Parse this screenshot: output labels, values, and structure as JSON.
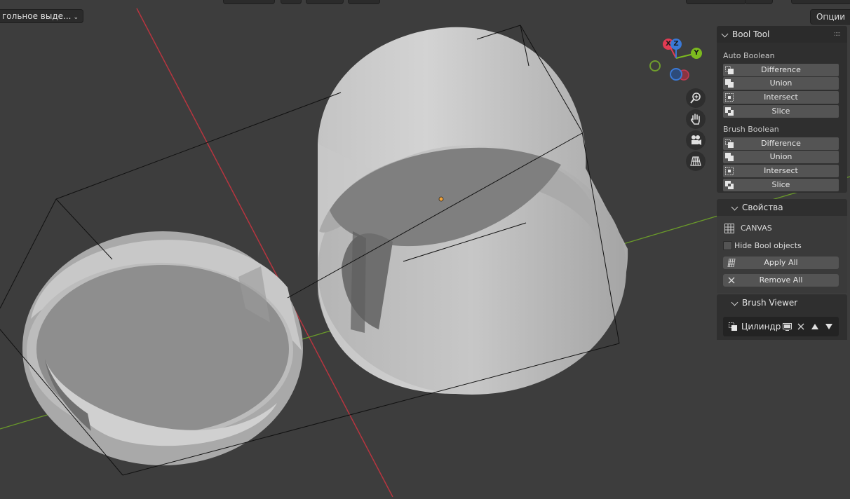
{
  "header": {
    "select_mode_label": "гольное выде...",
    "options_label": "Опции"
  },
  "gizmo": {
    "x_label": "X",
    "y_label": "Y",
    "z_label": "Z",
    "colors": {
      "x": "#e23b53",
      "y": "#7cba1f",
      "z": "#3a79d7"
    }
  },
  "nav_icons": [
    "zoom-icon",
    "pan-hand-icon",
    "camera-icon",
    "grid-icon"
  ],
  "bool_tool": {
    "title": "Bool Tool",
    "auto_boolean": {
      "label": "Auto Boolean",
      "buttons": [
        "Difference",
        "Union",
        "Intersect",
        "Slice"
      ]
    },
    "brush_boolean": {
      "label": "Brush Boolean",
      "buttons": [
        "Difference",
        "Union",
        "Intersect",
        "Slice"
      ]
    }
  },
  "properties": {
    "title": "Свойства",
    "canvas_label": "CANVAS",
    "hide_bool_label": "Hide Bool objects",
    "hide_bool_checked": false,
    "apply_all_label": "Apply All",
    "remove_all_label": "Remove All"
  },
  "brush_viewer": {
    "title": "Brush Viewer",
    "item_name": "Цилиндр"
  },
  "colors": {
    "viewport_bg": "#3d3d3d",
    "x_axis": "#b8353f",
    "y_axis": "#6a9a2a",
    "mesh_light": "#bdbdbd",
    "mesh_dark": "#8c8c8c",
    "origin": "#f2a33a"
  }
}
